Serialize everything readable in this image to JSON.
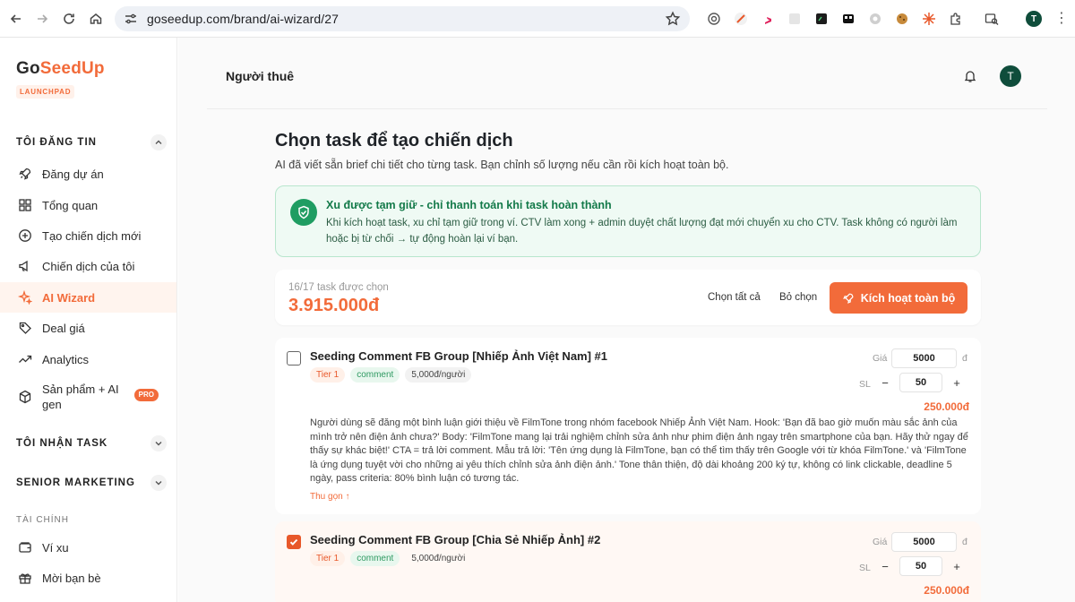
{
  "browser": {
    "url": "goseedup.com/brand/ai-wizard/27",
    "profile_initial": "T"
  },
  "sidebar": {
    "logo": {
      "part1": "Go",
      "part2": "SeedUp",
      "badge": "LAUNCHPAD"
    },
    "section_post": "TÔI ĐĂNG TIN",
    "items": [
      {
        "label": "Đăng dự án",
        "icon": "rocket-icon"
      },
      {
        "label": "Tổng quan",
        "icon": "grid-icon"
      },
      {
        "label": "Tạo chiến dịch mới",
        "icon": "plus-circle-icon"
      },
      {
        "label": "Chiến dịch của tôi",
        "icon": "megaphone-icon"
      },
      {
        "label": "AI Wizard",
        "icon": "sparkle-icon",
        "active": true
      },
      {
        "label": "Deal giá",
        "icon": "tag-icon"
      },
      {
        "label": "Analytics",
        "icon": "trend-icon"
      },
      {
        "label": "Sản phẩm + AI gen",
        "icon": "box-icon",
        "badge": "PRO"
      }
    ],
    "section_task": "TÔI NHẬN TASK",
    "section_senior": "SENIOR MARKETING",
    "finance_label": "TÀI CHÍNH",
    "finance_items": [
      {
        "label": "Ví xu",
        "icon": "wallet-icon"
      },
      {
        "label": "Mời bạn bè",
        "icon": "gift-icon"
      }
    ]
  },
  "topbar": {
    "title": "Người thuê",
    "avatar_initial": "T"
  },
  "page": {
    "title": "Chọn task để tạo chiến dịch",
    "subtitle": "AI đã viết sẵn brief chi tiết cho từng task. Bạn chỉnh số lượng nếu cần rồi kích hoạt toàn bộ."
  },
  "notice": {
    "title": "Xu được tạm giữ - chỉ thanh toán khi task hoàn thành",
    "body": "Khi kích hoạt task, xu chỉ tạm giữ trong ví. CTV làm xong + admin duyệt chất lượng đạt mới chuyển xu cho CTV. Task không có người làm hoặc bị từ chối → tự động hoàn lại ví bạn."
  },
  "summary": {
    "count": "16/17 task được chọn",
    "total": "3.915.000đ",
    "select_all": "Chọn tất cả",
    "deselect": "Bỏ chọn",
    "activate": "Kích hoạt toàn bộ"
  },
  "tasks": [
    {
      "title": "Seeding Comment FB Group [Nhiếp Ảnh Việt Nam] #1",
      "checked": false,
      "tier": "Tier 1",
      "type": "comment",
      "unit_price": "5,000đ/người",
      "price_label": "Giá",
      "price": "5000",
      "currency": "đ",
      "qty_label": "SL",
      "qty": "50",
      "total": "250.000đ",
      "description": "Người dùng sẽ đăng một bình luận giới thiệu về FilmTone trong nhóm facebook Nhiếp Ảnh Việt Nam. Hook: 'Bạn đã bao giờ muốn màu sắc ảnh của mình trở nên điện ảnh chưa?' Body: 'FilmTone mang lại trải nghiệm chỉnh sửa ảnh như phim điện ảnh ngay trên smartphone của bạn. Hãy thử ngay để thấy sự khác biệt!' CTA = trả lời comment. Mẫu trả lời: 'Tên ứng dụng là FilmTone, bạn có thể tìm thấy trên Google với từ khóa FilmTone.' và 'FilmTone là ứng dụng tuyệt vời cho những ai yêu thích chỉnh sửa ảnh điện ảnh.' Tone thân thiện, độ dài khoảng 200 ký tự, không có link clickable, deadline 5 ngày, pass criteria: 80% bình luận có tương tác.",
      "collapse": "Thu gọn ↑"
    },
    {
      "title": "Seeding Comment FB Group [Chia Sẻ Nhiếp Ảnh] #2",
      "checked": true,
      "tier": "Tier 1",
      "type": "comment",
      "unit_price": "5,000đ/người",
      "price_label": "Giá",
      "price": "5000",
      "currency": "đ",
      "qty_label": "SL",
      "qty": "50",
      "total": "250.000đ"
    }
  ]
}
